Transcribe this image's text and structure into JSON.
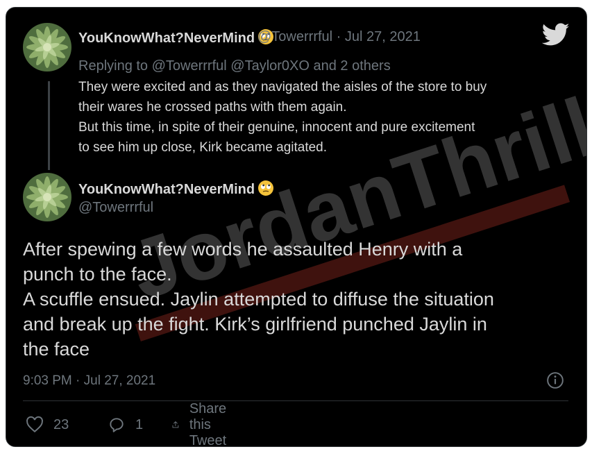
{
  "reply_tweet": {
    "display_name": "YouKnowWhat?NeverMind",
    "emoji": "face-with-rolling-eyes",
    "handle_time": "@Towerrrful · Jul 27, 2021",
    "replying_to": "Replying to @Towerrrful @Taylor0XO and 2 others",
    "text_lines": [
      "They were excited and as they navigated the aisles of the store to buy",
      "their wares he crossed paths with them again.",
      "But this time, in spite of their genuine, innocent and pure excitement",
      "to see him up close, Kirk became agitated."
    ]
  },
  "main_tweet": {
    "display_name": "YouKnowWhat?NeverMind",
    "emoji": "face-with-rolling-eyes",
    "handle": "@Towerrrful",
    "text_lines": [
      "After spewing a few words he assaulted Henry with a",
      "punch to the face.",
      "A scuffle ensued. Jaylin attempted to diffuse the situation",
      "and break up the fight. Kirk’s girlfriend punched Jaylin in",
      "the face"
    ],
    "timestamp": "9:03 PM · Jul 27, 2021"
  },
  "actions": {
    "likes": "23",
    "replies": "1",
    "share_label": "Share this Tweet"
  },
  "watermark": "JordanThrilla.",
  "colors": {
    "background": "#000000",
    "text": "#d9d9d9",
    "muted": "#6e767d",
    "watermark_red": "#c0392b"
  },
  "icons": [
    "twitter-bird-icon",
    "info-icon",
    "heart-icon",
    "reply-bubble-icon",
    "share-icon"
  ]
}
